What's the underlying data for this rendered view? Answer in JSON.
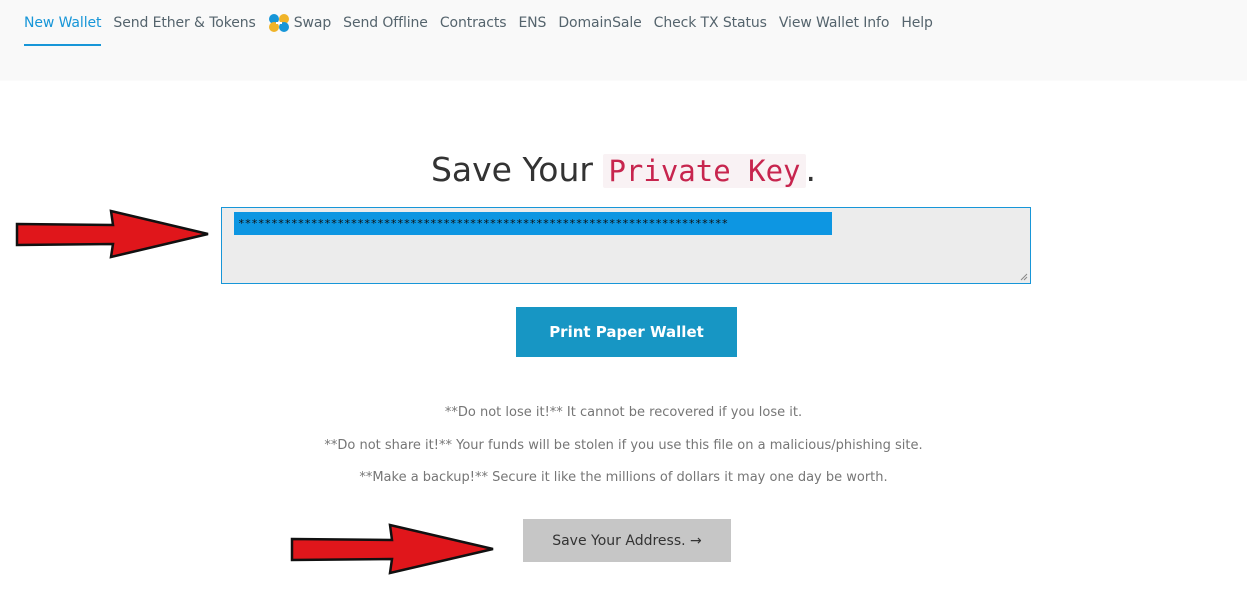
{
  "nav": {
    "items": [
      {
        "label": "New Wallet",
        "active": true
      },
      {
        "label": "Send Ether & Tokens"
      },
      {
        "label": "Swap",
        "icon": "swap-icon"
      },
      {
        "label": "Send Offline"
      },
      {
        "label": "Contracts"
      },
      {
        "label": "ENS"
      },
      {
        "label": "DomainSale"
      },
      {
        "label": "Check TX Status"
      },
      {
        "label": "View Wallet Info"
      },
      {
        "label": "Help"
      }
    ]
  },
  "heading": {
    "prefix": "Save Your",
    "code": "Private Key",
    "suffix": "."
  },
  "private_key": {
    "value": "**************************************************************************"
  },
  "buttons": {
    "print": "Print Paper Wallet",
    "save_address": "Save Your Address. →"
  },
  "warnings": [
    "**Do not lose it!** It cannot be recovered if you lose it.",
    "**Do not share it!** Your funds will be stolen if you use this file on a malicious/phishing site.",
    "**Make a backup!** Secure it like the millions of dollars it may one day be worth."
  ],
  "colors": {
    "accent": "#1796d8",
    "arrow": "#e0161b",
    "code": "#c7254e"
  }
}
